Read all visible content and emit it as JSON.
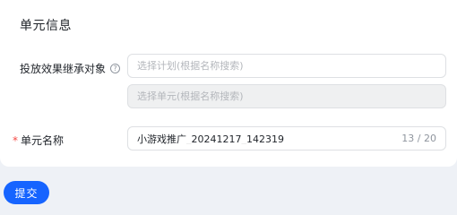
{
  "section": {
    "title": "单元信息"
  },
  "inherit": {
    "label": "投放效果继承对象",
    "help_icon": "question-circle-icon",
    "plan_placeholder": "选择计划(根据名称搜索)",
    "unit_placeholder": "选择单元(根据名称搜索)"
  },
  "unit_name": {
    "required_mark": "*",
    "label": "单元名称",
    "value": "小游戏推广_20241217_142319",
    "counter": "13 / 20"
  },
  "actions": {
    "submit_label": "提交"
  },
  "colors": {
    "primary": "#1664ff",
    "required": "#f54a45",
    "background": "#eef1f6"
  }
}
